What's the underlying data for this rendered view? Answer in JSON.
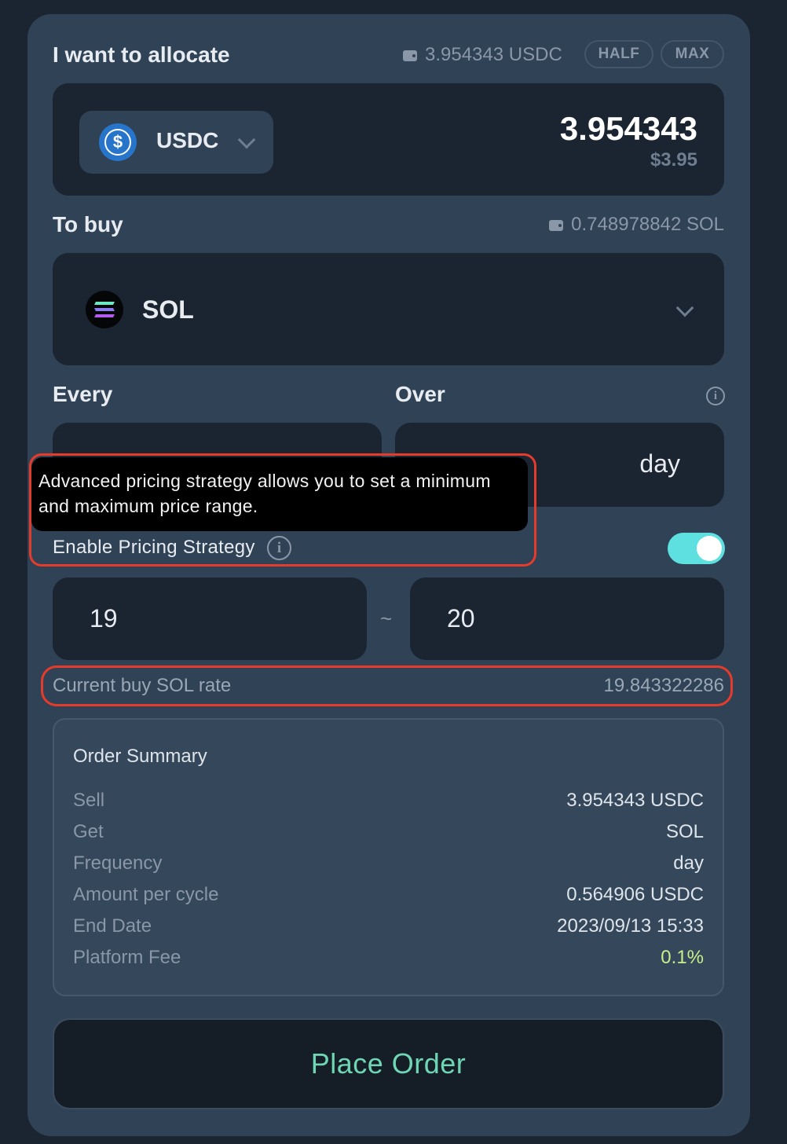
{
  "allocate": {
    "label": "I want to allocate",
    "balance": "3.954343 USDC",
    "half_label": "HALF",
    "max_label": "MAX",
    "token": "USDC",
    "amount": "3.954343",
    "usd_value": "$3.95"
  },
  "buy": {
    "label": "To buy",
    "balance": "0.748978842 SOL",
    "token": "SOL"
  },
  "schedule": {
    "every_label": "Every",
    "over_label": "Over",
    "over_unit": "day"
  },
  "tooltip": {
    "text": "Advanced pricing strategy allows you to set a minimum and maximum price range."
  },
  "pricing": {
    "label": "Enable Pricing Strategy",
    "enabled": true,
    "min_value": "19",
    "separator": "~",
    "max_value": "20",
    "rate_label": "Current buy SOL rate",
    "rate_value": "19.843322286"
  },
  "summary": {
    "title": "Order Summary",
    "rows": [
      {
        "label": "Sell",
        "value": "3.954343 USDC"
      },
      {
        "label": "Get",
        "value": "SOL"
      },
      {
        "label": "Frequency",
        "value": "day"
      },
      {
        "label": "Amount per cycle",
        "value": "0.564906 USDC"
      },
      {
        "label": "End Date",
        "value": "2023/09/13 15:33"
      },
      {
        "label": "Platform Fee",
        "value": "0.1%"
      }
    ]
  },
  "place_order_label": "Place Order",
  "colors": {
    "accent": "#6fd6b3",
    "toggle": "#5fe0e0",
    "fee": "#c6f08a",
    "highlight": "#e53b2b"
  }
}
